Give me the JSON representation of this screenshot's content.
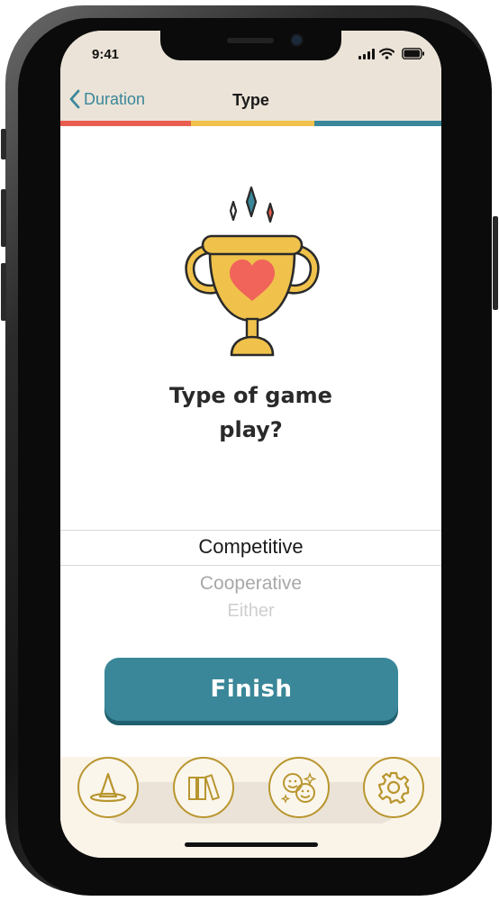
{
  "status_bar": {
    "time": "9:41"
  },
  "nav": {
    "back_label": "Duration",
    "title": "Type"
  },
  "progress": {
    "colors": [
      "#e85d4f",
      "#f0c24b",
      "#3a8799"
    ]
  },
  "question": {
    "line1": "Type of game",
    "line2": "play?"
  },
  "picker": {
    "selected": "Competitive",
    "options": [
      "Cooperative",
      "Either"
    ]
  },
  "finish_button": {
    "label": "Finish"
  },
  "tab_bar": {
    "tabs": [
      {
        "icon": "wizard-hat-icon"
      },
      {
        "icon": "books-icon"
      },
      {
        "icon": "faces-icon"
      },
      {
        "icon": "gear-icon"
      }
    ]
  },
  "colors": {
    "accent": "#3a8799",
    "header_bg": "#ebe3d7",
    "tab_border": "#b8962f"
  }
}
